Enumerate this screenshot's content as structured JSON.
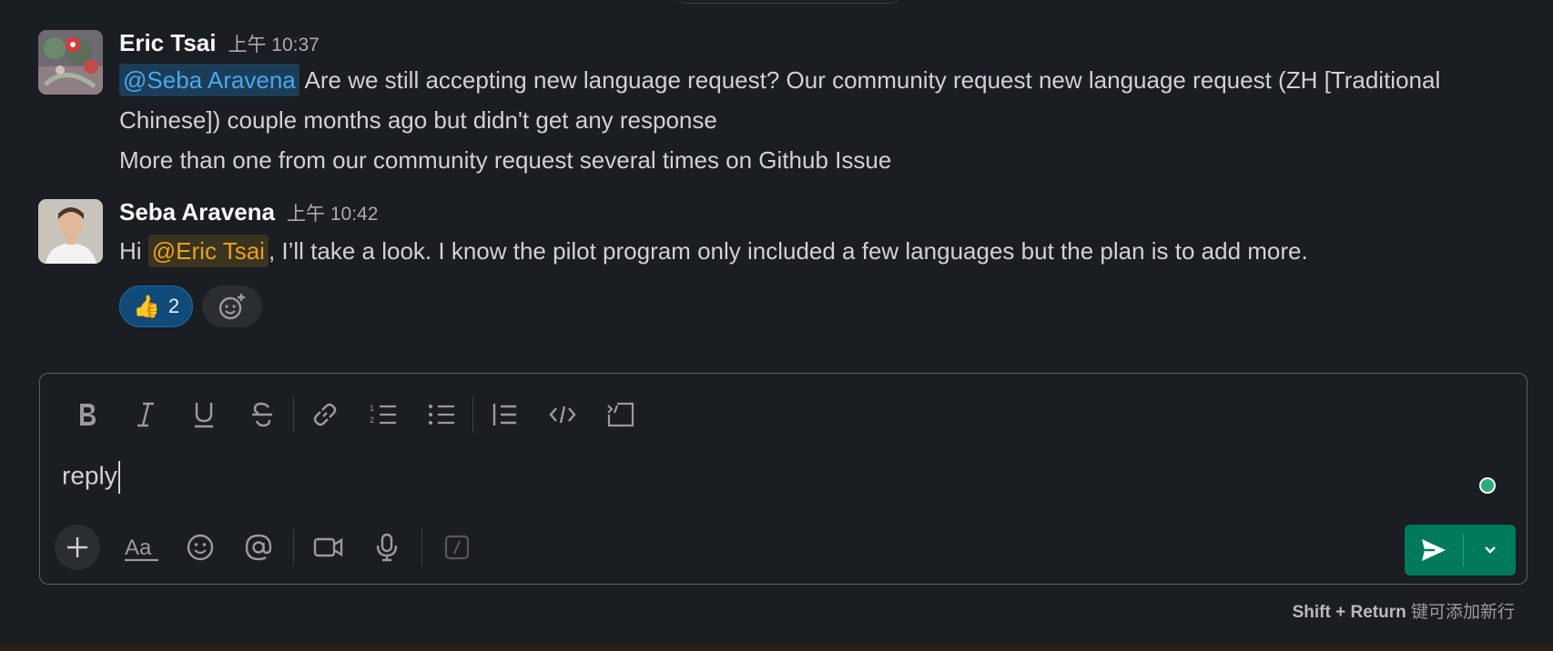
{
  "messages": [
    {
      "author": "Eric Tsai",
      "time": "上午 10:37",
      "mention": "@Seba Aravena",
      "line1_rest": " Are we still accepting new language request? Our community request new language request (ZH [Traditional Chinese]) couple months ago but didn't get any response",
      "line2": "More than one from our community request several times on Github Issue"
    },
    {
      "author": "Seba Aravena",
      "time": "上午 10:42",
      "prefix": "Hi ",
      "mention": "@Eric Tsai",
      "rest": ", I’ll take a look. I know the pilot program only included a few languages but the plan is to add more.",
      "reaction": {
        "emoji": "👍",
        "count": "2"
      }
    }
  ],
  "composer": {
    "value": "reply",
    "toolbar_icons": [
      "bold-icon",
      "italic-icon",
      "underline-icon",
      "strikethrough-icon",
      "link-icon",
      "ordered-list-icon",
      "bulleted-list-icon",
      "blockquote-icon",
      "code-icon",
      "code-block-icon"
    ],
    "bottom_icons": [
      "plus-icon",
      "formatting-icon",
      "emoji-icon",
      "mention-icon",
      "video-icon",
      "microphone-icon",
      "shortcuts-icon"
    ],
    "hint_bold": "Shift + Return",
    "hint_rest": " 键可添加新行"
  },
  "colors": {
    "send": "#007a5a",
    "mention_blue": "#4aa7e8",
    "mention_gold": "#e8a317",
    "presence": "#2bac76"
  }
}
